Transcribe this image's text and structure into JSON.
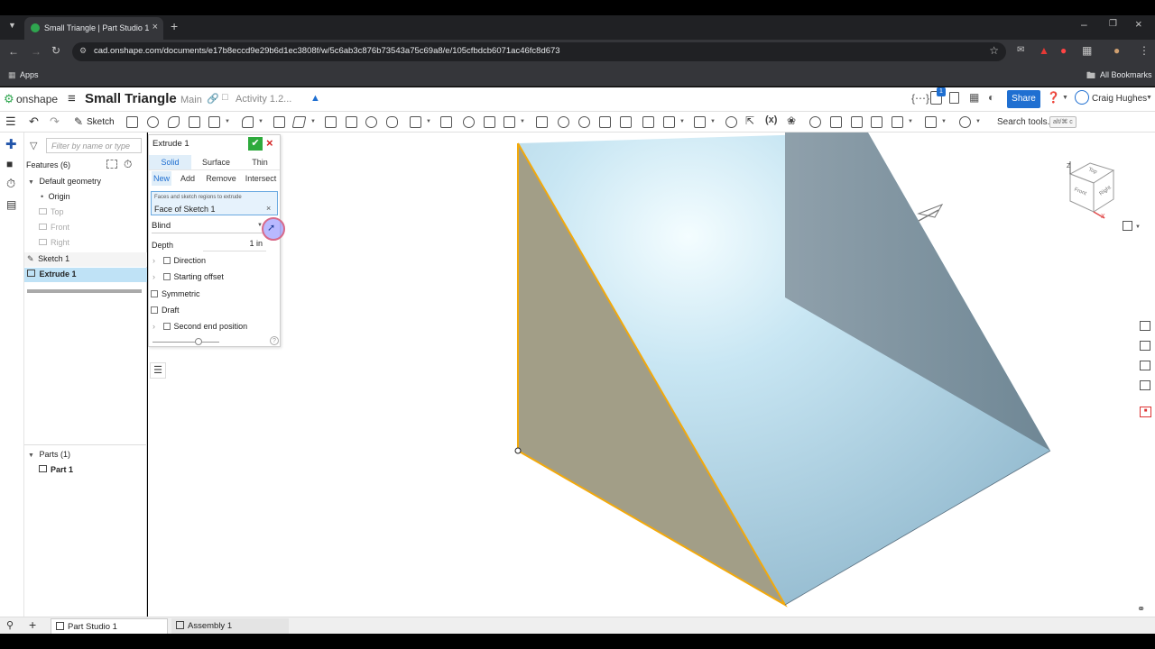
{
  "browser": {
    "tab_title": "Small Triangle | Part Studio 1",
    "url": "cad.onshape.com/documents/e17b8eccd9e29b6d1ec3808f/w/5c6ab3c876b73543a75c69a8/e/105cfbdcb6071ac46fc8d673",
    "apps_label": "Apps",
    "all_bookmarks": "All Bookmarks"
  },
  "header": {
    "logo": "onshape",
    "doc_title": "Small Triangle",
    "branch": "Main",
    "activity": "Activity 1.2...",
    "notif_count": "1",
    "share_label": "Share",
    "user_name": "Craig Hughes"
  },
  "toolbar": {
    "sketch_label": "Sketch",
    "search_label": "Search tools...",
    "search_shortcut": "alt/⌘ c"
  },
  "features": {
    "filter_placeholder": "Filter by name or type",
    "header": "Features (6)",
    "default_geometry": "Default geometry",
    "origin": "Origin",
    "top": "Top",
    "front": "Front",
    "right": "Right",
    "sketch1": "Sketch 1",
    "extrude1": "Extrude 1",
    "parts_header": "Parts (1)",
    "part1": "Part 1"
  },
  "dialog": {
    "title": "Extrude 1",
    "types": [
      "Solid",
      "Surface",
      "Thin"
    ],
    "ops": [
      "New",
      "Add",
      "Remove",
      "Intersect"
    ],
    "sel_hint": "Faces and sketch regions to extrude",
    "sel_value": "Face of Sketch 1",
    "end_type": "Blind",
    "depth_label": "Depth",
    "depth_value": "1 in",
    "direction": "Direction",
    "starting_offset": "Starting offset",
    "symmetric": "Symmetric",
    "draft": "Draft",
    "second_end": "Second end position"
  },
  "viewcube": {
    "top": "Top",
    "front": "Front",
    "right": "Right",
    "z": "Z",
    "x": "X"
  },
  "bottom_tabs": {
    "part_studio": "Part Studio 1",
    "assembly": "Assembly 1"
  }
}
